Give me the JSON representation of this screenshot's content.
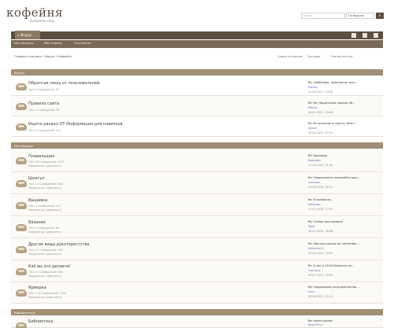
{
  "header": {
    "logo": "кофейня",
    "logo_sub": "kofeinia.org"
  },
  "search": {
    "placeholder": "Поиск…",
    "scope": "По форуму",
    "button_icon": "search-icon"
  },
  "nav": {
    "active_tab": "Форум",
    "right_icons": [
      "user-icon",
      "envelope-icon",
      "menu-icon"
    ],
    "sub_links": [
      "Мои вопросы",
      "Мои ответы",
      "Не ответил"
    ]
  },
  "breadcrumbs": {
    "path": "Главная страница • Форум • Кофейня",
    "right": [
      "Самые активные",
      "Текущие",
      "Неотвеченные"
    ]
  },
  "categories": [
    {
      "title": "Форум",
      "forums": [
        {
          "title": "Обратная связь от пользователей.",
          "stats": "Тем: 3  Сообщений: 29",
          "moderator": "",
          "last_title": "Re: Проблемы, пожелания, воп…",
          "last_author": "Mallory",
          "last_date": "10.05.2021, 23:28"
        },
        {
          "title": "Правила сайта",
          "stats": "Тем: 1  Сообщений: 59",
          "moderator": "",
          "last_title": "Re: Re: Защитники недели 26…",
          "last_author": "Marina",
          "last_date": "04.01.2021, 23:36"
        },
        {
          "title": "Ищите раздел ОТ Информация для новичков.",
          "stats": "Тем: 4  Сообщений: 101",
          "moderator": "",
          "last_title": "Re: Вступление в группу (Факт…",
          "last_author": "sensei",
          "last_date": "14.04.2020, 07:41"
        }
      ]
    },
    {
      "title": "Мастерская",
      "forums": [
        {
          "title": "Плавильщик",
          "stats": "Тем: 35  Сообщений: 1072",
          "moderator": "Модератор: Администр",
          "last_title": "Re: Nasirabai",
          "last_author": "Doscadar",
          "last_date": "17.08.2020, 21:42"
        },
        {
          "title": "Шкатул",
          "stats": "Тем: 14  Сообщений: 408",
          "moderator": "Модератор: Администр",
          "last_title": "Re: Нахрсинаете пожелайте каж…",
          "last_author": "unknown",
          "last_date": "23.08.2018, 05:31"
        },
        {
          "title": "Вышивка",
          "stats": "Тем: 4  Сообщений: 101",
          "moderator": "Модератор: Администр",
          "last_title": "Re: Я вязально…",
          "last_author": "unknown",
          "last_date": "17.07.2018, 17:52"
        },
        {
          "title": "Вязание",
          "stats": "Тем: 5  Сообщений: 66",
          "moderator": "Модератор: Администр",
          "last_title": "Re: Схемы для вязания",
          "last_author": "Tokki",
          "last_date": "28.07.2019, 18:46"
        },
        {
          "title": "Другие виды рукоткрестства",
          "stats": "Тем: 17  Сообщений: 189",
          "moderator": "Модератор: Администр",
          "last_title": "Re: Мастер-классы по плетению…",
          "last_author": "Vikterina/11",
          "last_date": "20.08.2021, 20:29"
        },
        {
          "title": "Как вы это делаете!",
          "stats": "Тем: 21  Сообщений: 498",
          "moderator": "Модератор: Администр",
          "last_title": "Re: 6 лет в 19-00 Nakhnira по…",
          "last_author": "Frenchus",
          "last_date": "03.07.2017, 13:59"
        },
        {
          "title": "Ярмарка",
          "stats": "Тем: 119  Сообщений: 1736",
          "moderator": "Модератор: Администр",
          "last_title": "Re: Продолжаю сотрудничество…",
          "last_author": "отеч",
          "last_date": "28.08.2021, 22:14"
        }
      ]
    },
    {
      "title": "Библиотечка",
      "forums": [
        {
          "title": "Библиотека",
          "stats": "",
          "moderator": "",
          "last_title": "Re: книги детям",
          "last_author": "Koorai2011",
          "last_date": ""
        }
      ]
    }
  ],
  "colors": {
    "nav_dark": "#5c4f40",
    "category_bar": "#a08f75",
    "link": "#5a6fb8"
  }
}
